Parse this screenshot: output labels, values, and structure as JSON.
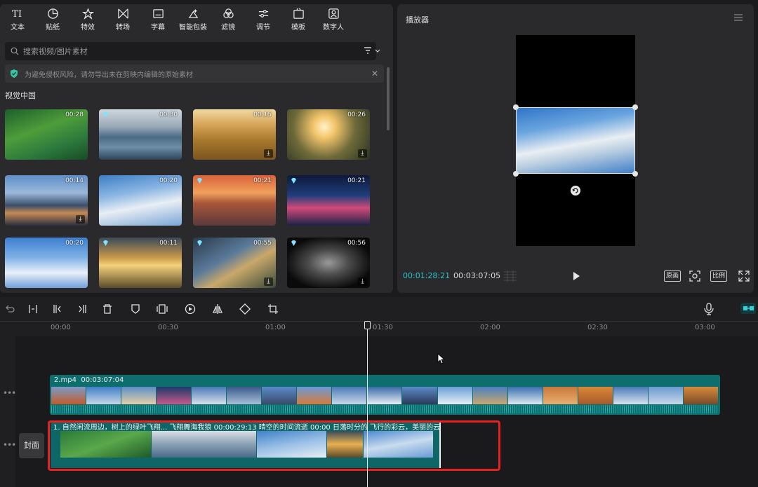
{
  "toolbar": {
    "items": [
      {
        "label": "文本",
        "icon": "text-icon"
      },
      {
        "label": "贴纸",
        "icon": "sticker-icon"
      },
      {
        "label": "特效",
        "icon": "effects-icon"
      },
      {
        "label": "转场",
        "icon": "transition-icon"
      },
      {
        "label": "字幕",
        "icon": "subtitle-icon"
      },
      {
        "label": "智能包装",
        "icon": "smart-pack-icon"
      },
      {
        "label": "滤镜",
        "icon": "filter-icon"
      },
      {
        "label": "调节",
        "icon": "adjust-icon"
      },
      {
        "label": "模板",
        "icon": "template-icon"
      },
      {
        "label": "数字人",
        "icon": "digital-human-icon"
      }
    ]
  },
  "search": {
    "placeholder": "搜索视频/图片素材"
  },
  "notice": {
    "text": "为避免侵权风险，请勿导出未在剪映内编辑的原始素材"
  },
  "library": {
    "section_title": "视觉中国",
    "items": [
      {
        "duration": "00:28",
        "vip": false,
        "download": false
      },
      {
        "duration": "00:30",
        "vip": true,
        "download": false
      },
      {
        "duration": "00:15",
        "vip": false,
        "download": true
      },
      {
        "duration": "00:26",
        "vip": false,
        "download": true
      },
      {
        "duration": "00:14",
        "vip": false,
        "download": true
      },
      {
        "duration": "00:20",
        "vip": false,
        "download": false
      },
      {
        "duration": "00:21",
        "vip": true,
        "download": false
      },
      {
        "duration": "00:21",
        "vip": true,
        "download": false
      },
      {
        "duration": "00:20",
        "vip": false,
        "download": false
      },
      {
        "duration": "00:11",
        "vip": true,
        "download": false
      },
      {
        "duration": "00:55",
        "vip": true,
        "download": true
      },
      {
        "duration": "00:56",
        "vip": true,
        "download": true
      }
    ]
  },
  "player": {
    "title": "播放器",
    "current_time": "00:01:28:21",
    "total_time": "00:03:07:05",
    "btn_original": "原画",
    "btn_ratio": "比例"
  },
  "timeline": {
    "ruler": [
      "00:00",
      "00:30",
      "01:00",
      "01:30",
      "02:00",
      "02:30",
      "03:00"
    ],
    "main_clip": {
      "name": "2.mp4",
      "duration": "00:03:07:04"
    },
    "sub_clip_labels": "1. 自然闲流周边，树上的绿叶飞翔... 飞翔舞海我狼   00:00:29:13      晴空的时间流逝  00:00   日落时分的    飞行的彩云，美丽的云",
    "sub_clip_duration": "00:00:29:13",
    "cover_label": "封面"
  }
}
